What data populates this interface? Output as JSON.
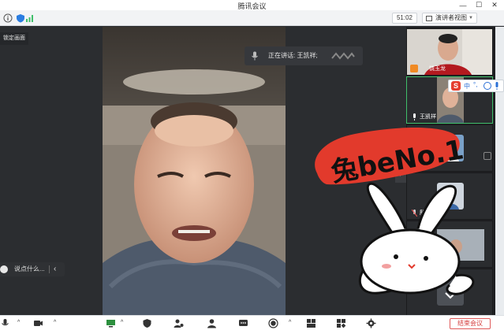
{
  "window": {
    "title": "腾讯会议",
    "minimize_glyph": "—",
    "maximize_glyph": "☐",
    "close_glyph": "✕"
  },
  "toolbar": {
    "timer": "51:02",
    "view_mode": "演讲者视图"
  },
  "stage": {
    "lock_label": "锁定画面",
    "speaking_label": "正在讲话: 王凯祥;",
    "chat_placeholder": "说点什么..."
  },
  "sidebar": {
    "participants": [
      {
        "name": "饶玉龙"
      },
      {
        "name": "王凯祥"
      },
      {
        "name": "B"
      },
      {
        "name": "殷"
      },
      {
        "name": ""
      },
      {
        "name": ""
      }
    ]
  },
  "ime": {
    "logo": "S",
    "lang": "中",
    "punct": "°,"
  },
  "sticker": {
    "text": "兔beNo.1"
  },
  "bottombar": {
    "end_label": "结束会议"
  },
  "colors": {
    "accent_green": "#3fbf6a",
    "end_red": "#d33b3b",
    "sticker_red": "#e23a2c"
  }
}
